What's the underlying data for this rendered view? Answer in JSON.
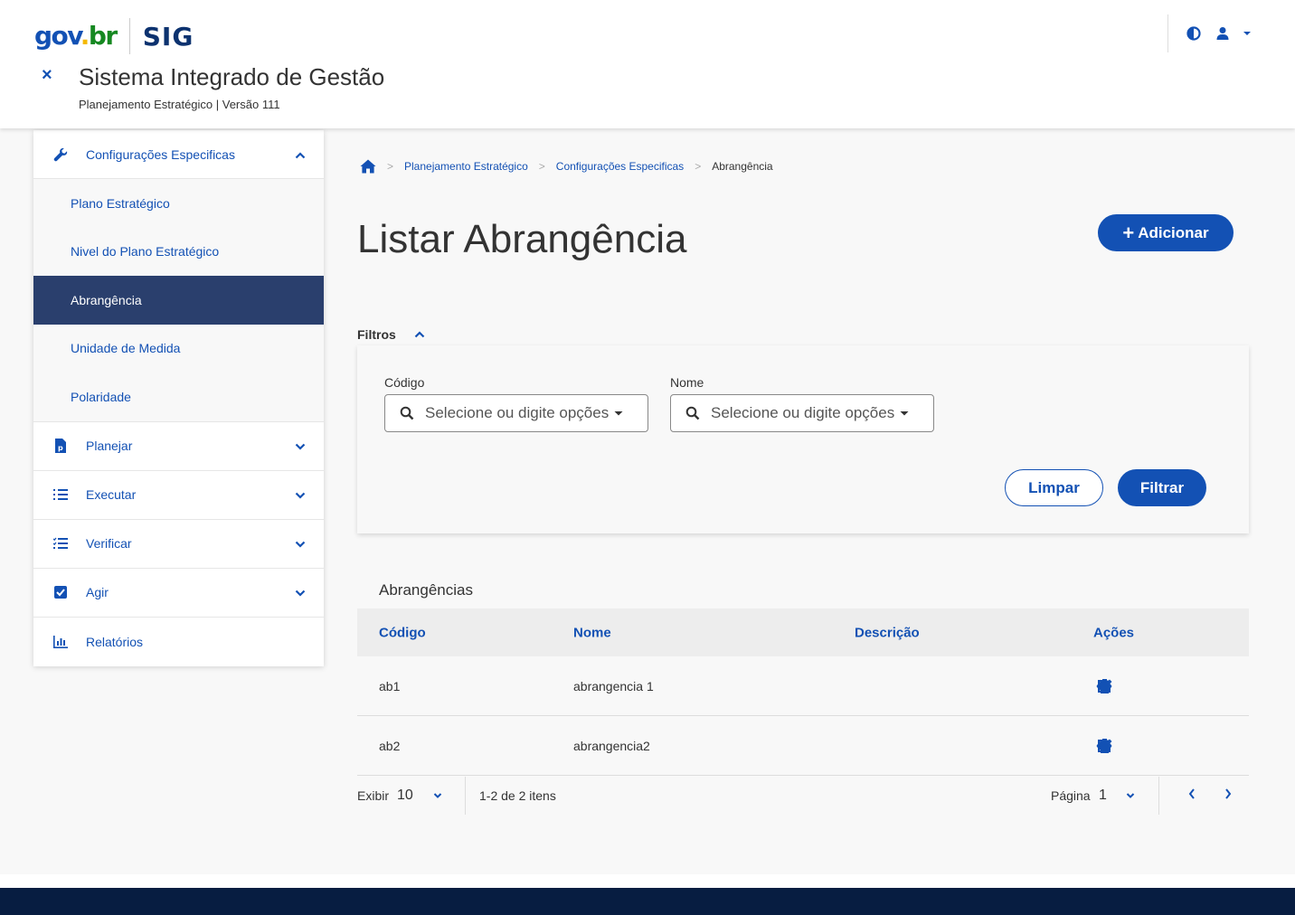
{
  "header": {
    "logo_gov": "gov",
    "logo_dot": ".",
    "logo_br": "br",
    "logo_sig": "SIG",
    "system_title": "Sistema Integrado de Gestão",
    "system_subtitle": "Planejamento Estratégico | Versão 111",
    "close_symbol": "×"
  },
  "sidebar": {
    "groups": [
      {
        "label": "Configurações Especificas",
        "icon": "wrench-icon",
        "expanded": true,
        "items": [
          {
            "label": "Plano Estratégico"
          },
          {
            "label": "Nivel do Plano Estratégico"
          },
          {
            "label": "Abrangência",
            "active": true
          },
          {
            "label": "Unidade de Medida"
          },
          {
            "label": "Polaridade"
          }
        ]
      },
      {
        "label": "Planejar",
        "icon": "file-p-icon"
      },
      {
        "label": "Executar",
        "icon": "list-ordered-icon"
      },
      {
        "label": "Verificar",
        "icon": "list-check-icon"
      },
      {
        "label": "Agir",
        "icon": "checkbox-icon"
      },
      {
        "label": "Relatórios",
        "icon": "bar-chart-icon"
      }
    ]
  },
  "breadcrumb": {
    "items": [
      "Planejamento Estratégico",
      "Configurações Especificas"
    ],
    "current": "Abrangência",
    "separator": ">"
  },
  "page": {
    "title": "Listar Abrangência",
    "add_button": "Adicionar",
    "add_plus": "+"
  },
  "filters": {
    "toggle_label": "Filtros",
    "codigo_label": "Código",
    "codigo_placeholder": "Selecione ou digite opções",
    "nome_label": "Nome",
    "nome_placeholder": "Selecione ou digite opções",
    "clear_button": "Limpar",
    "filter_button": "Filtrar"
  },
  "table": {
    "title": "Abrangências",
    "columns": [
      "Código",
      "Nome",
      "Descrição",
      "Ações"
    ],
    "rows": [
      {
        "codigo": "ab1",
        "nome": "abrangencia 1",
        "descricao": ""
      },
      {
        "codigo": "ab2",
        "nome": "abrangencia2",
        "descricao": ""
      }
    ]
  },
  "pagination": {
    "show_label": "Exibir",
    "page_size": "10",
    "range_text": "1-2 de 2 itens",
    "page_label": "Página",
    "page_number": "1",
    "prev_symbol": "‹",
    "next_symbol": "›"
  },
  "colors": {
    "primary": "#1351b4",
    "active_sidebar": "#2a3f6d",
    "footer": "#071d41"
  }
}
